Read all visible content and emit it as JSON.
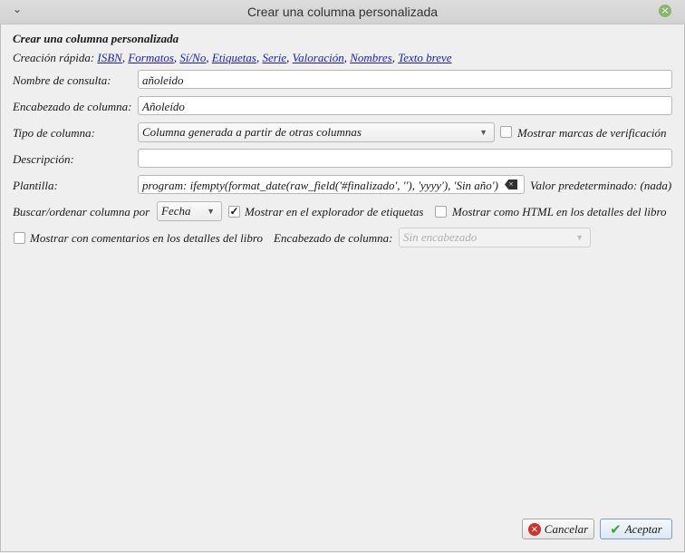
{
  "window": {
    "title": "Crear una columna personalizada"
  },
  "heading": "Crear una columna personalizada",
  "quick": {
    "label": "Creación rápida:",
    "links": [
      "ISBN",
      "Formatos",
      "Sí/No",
      "Etiquetas",
      "Serie",
      "Valoración",
      "Nombres",
      "Texto breve"
    ]
  },
  "fields": {
    "lookup_label": "Nombre de consulta:",
    "lookup_value": "añoleido",
    "heading_label": "Encabezado de columna:",
    "heading_value": "Añoleído",
    "type_label": "Tipo de columna:",
    "type_value": "Columna generada a partir de otras columnas",
    "checkmarks_label": "Mostrar marcas de verificación",
    "desc_label": "Descripción:",
    "desc_value": "",
    "template_label": "Plantilla:",
    "template_value": "program: ifempty(format_date(raw_field('#finalizado', ''), 'yyyy'), 'Sin año')",
    "default_label": "Valor predeterminado: (nada)",
    "sort_label": "Buscar/ordenar columna por",
    "sort_value": "Fecha",
    "tagbrowser_label": "Mostrar en el explorador de etiquetas",
    "tagbrowser_checked": true,
    "html_label": "Mostrar como HTML en los detalles del libro",
    "html_checked": false,
    "comments_label": "Mostrar con comentarios en los detalles del libro",
    "comments_checked": false,
    "comments_heading_label": "Encabezado de columna:",
    "comments_heading_value": "Sin encabezado"
  },
  "buttons": {
    "cancel": "Cancelar",
    "ok": "Aceptar"
  }
}
